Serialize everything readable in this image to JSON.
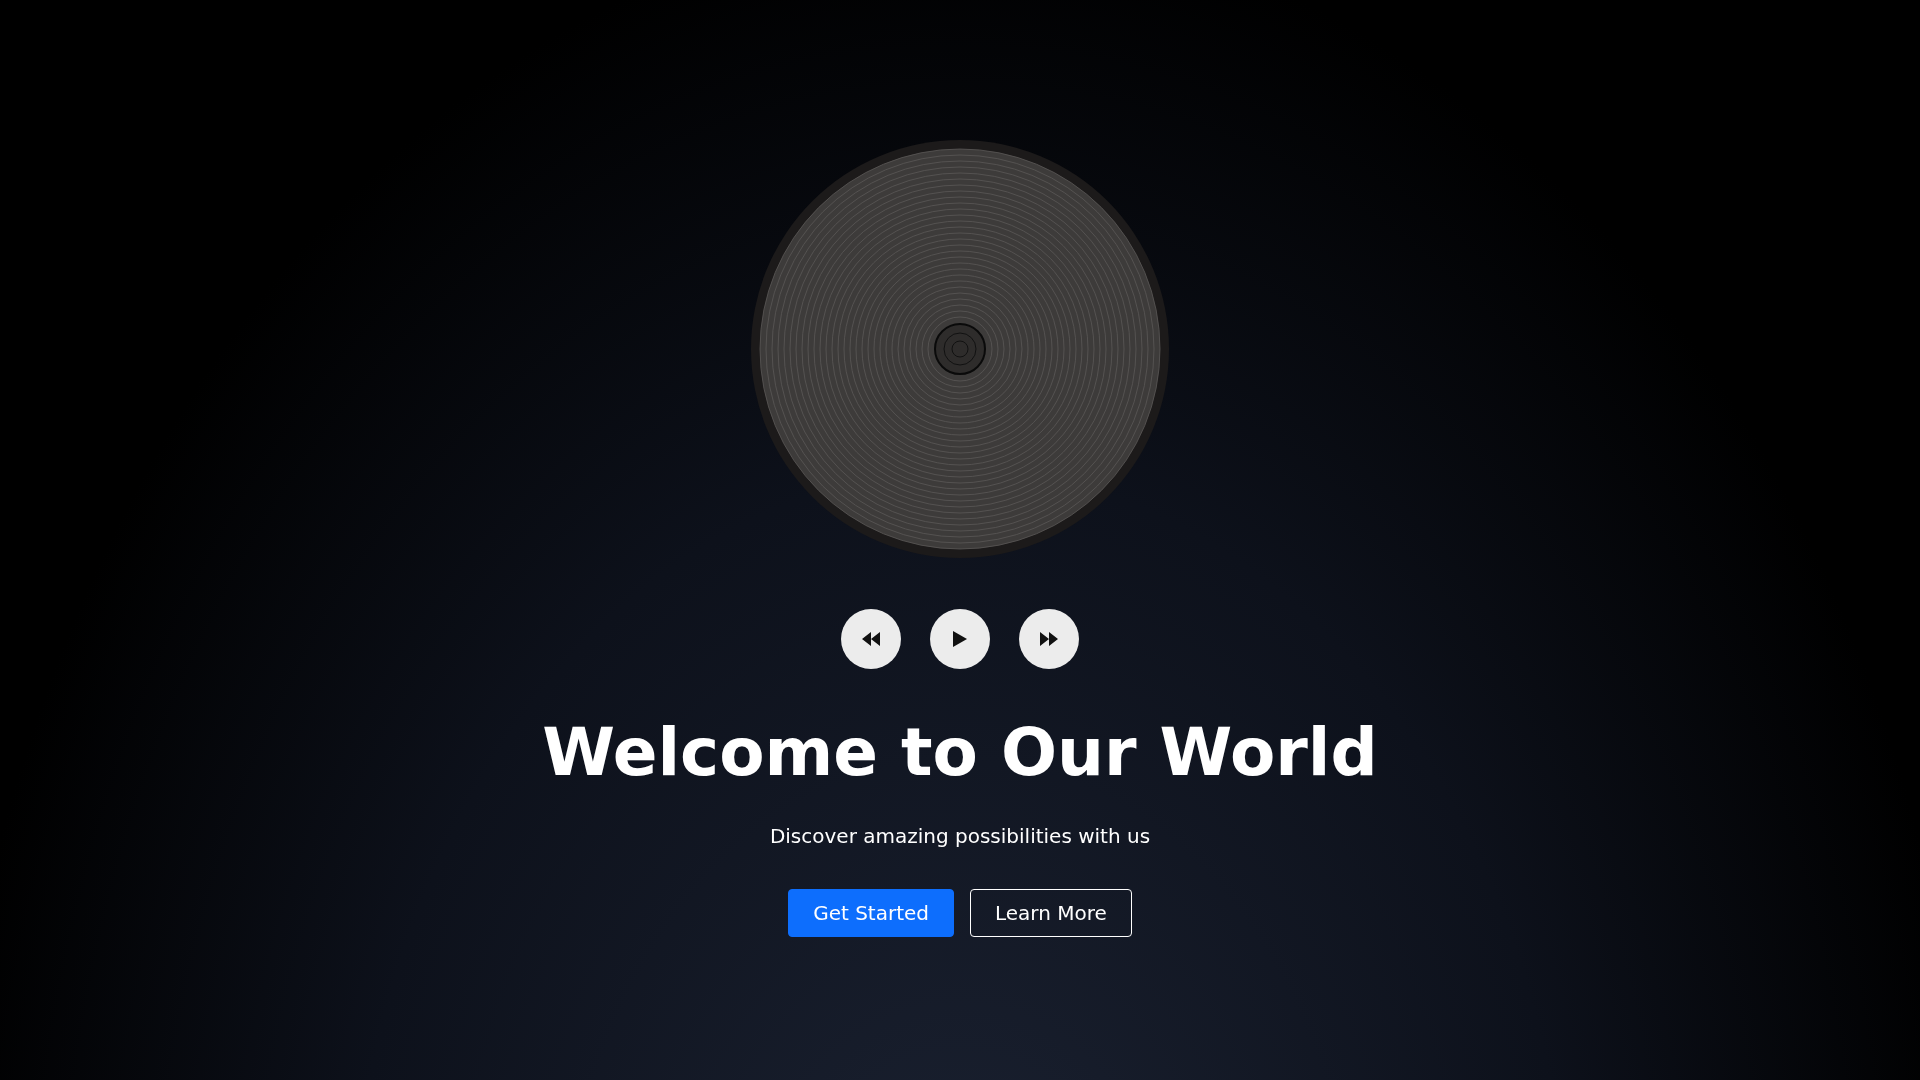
{
  "hero": {
    "title": "Welcome to Our World",
    "subtitle": "Discover amazing possibilities with us",
    "buttons": [
      {
        "label": "Get Started",
        "kind": "primary"
      },
      {
        "label": "Learn More",
        "kind": "outline"
      }
    ]
  }
}
